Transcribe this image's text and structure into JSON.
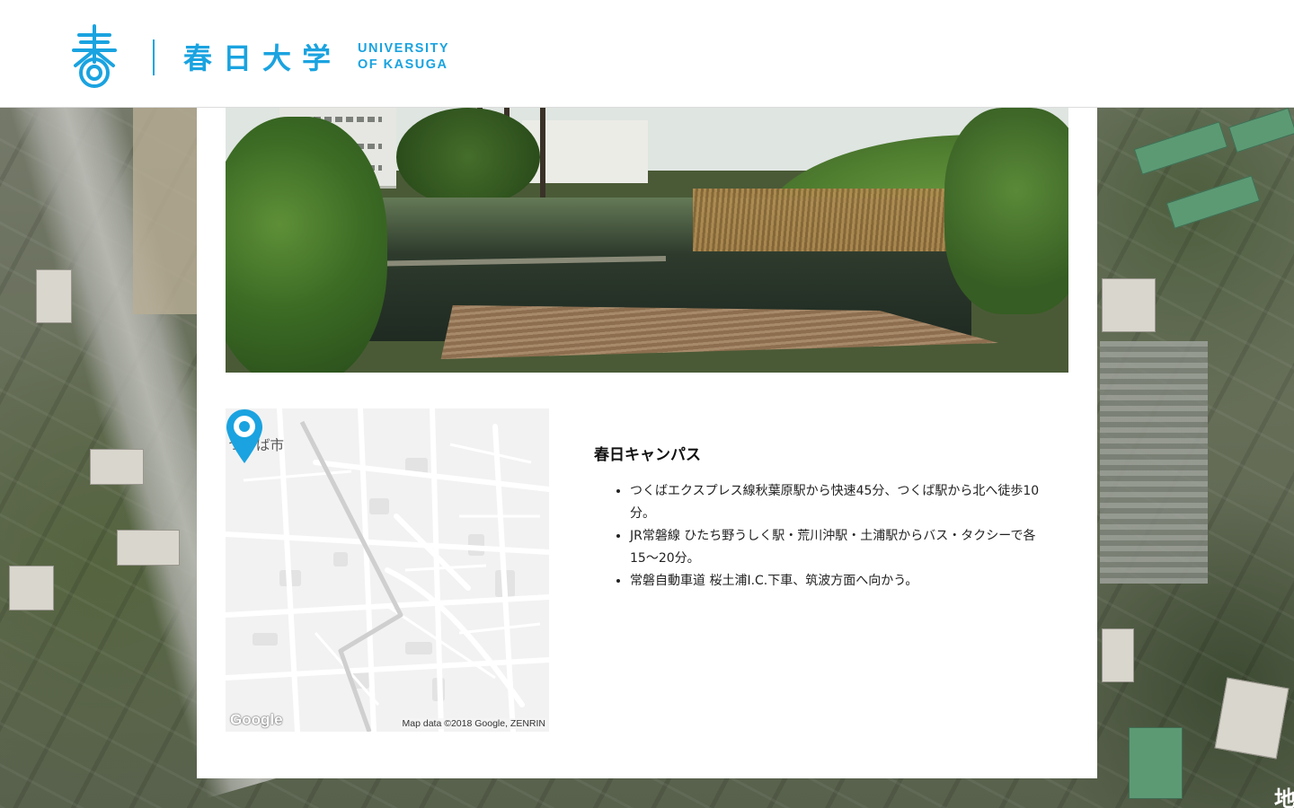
{
  "header": {
    "logo_kanji": "春",
    "name_jp": "春日大学",
    "name_en_line1": "UNIVERSITY",
    "name_en_line2": "OF KASUGA",
    "brand_color": "#1aa3e0"
  },
  "background": {
    "aerial_text": "地"
  },
  "map": {
    "city_label": "つくば市",
    "logo_text": "Google",
    "attribution": "Map data ©2018 Google, ZENRIN",
    "pin_icon": "location-pin-icon",
    "pin_color": "#1aa3e0"
  },
  "campus": {
    "title": "春日キャンパス",
    "access": [
      "つくばエクスプレス線秋葉原駅から快速45分、つくば駅から北へ徒歩10分。",
      "JR常磐線 ひたち野うしく駅・荒川沖駅・土浦駅からバス・タクシーで各15〜20分。",
      "常磐自動車道 桜土浦I.C.下車、筑波方面へ向かう。"
    ]
  }
}
